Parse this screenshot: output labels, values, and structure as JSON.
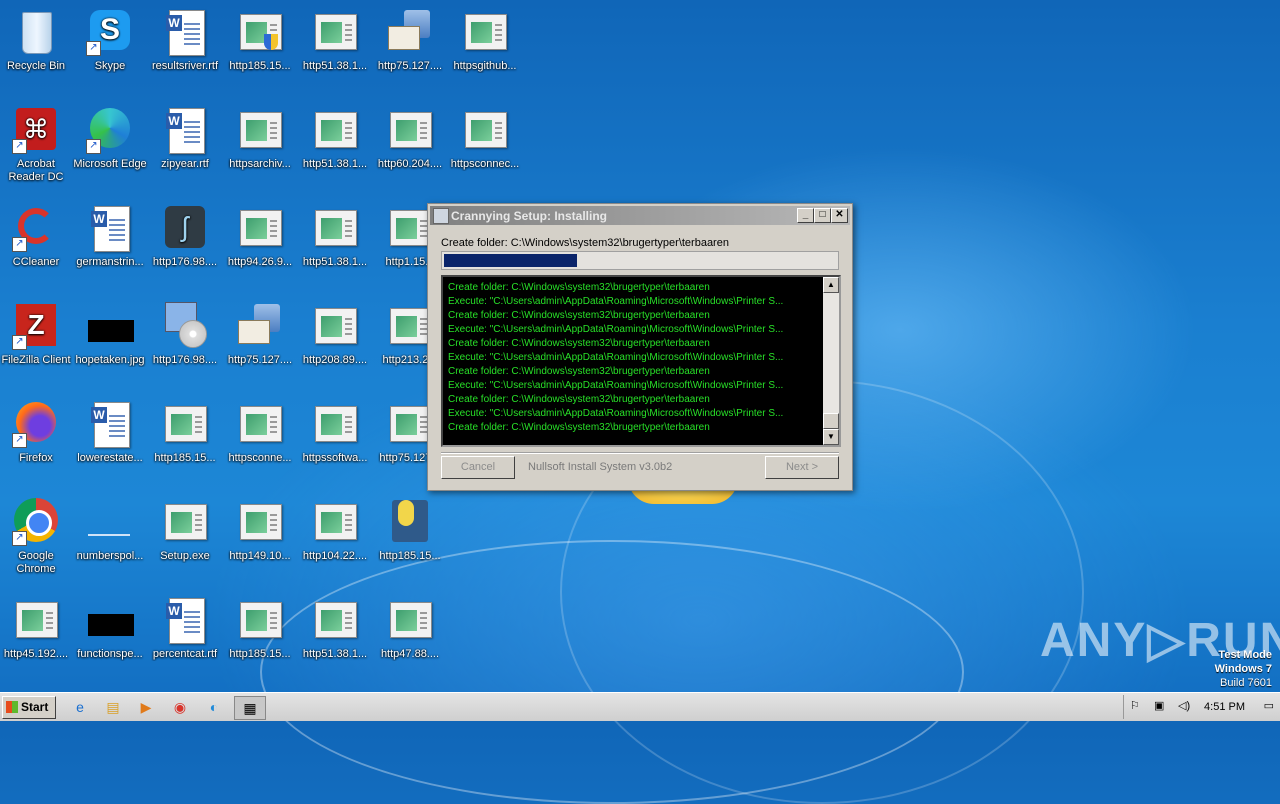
{
  "desktop": {
    "icons": [
      {
        "label": "Recycle Bin",
        "type": "recycle"
      },
      {
        "label": "Skype",
        "type": "skype"
      },
      {
        "label": "resultsriver.rtf",
        "type": "doc"
      },
      {
        "label": "http185.15...",
        "type": "web-shield"
      },
      {
        "label": "http51.38.1...",
        "type": "web"
      },
      {
        "label": "http75.127....",
        "type": "mail"
      },
      {
        "label": "httpsgithub...",
        "type": "web"
      },
      {
        "label": "Acrobat Reader DC",
        "type": "acrobat"
      },
      {
        "label": "Microsoft Edge",
        "type": "edge"
      },
      {
        "label": "zipyear.rtf",
        "type": "doc"
      },
      {
        "label": "httpsarchiv...",
        "type": "web"
      },
      {
        "label": "http51.38.1...",
        "type": "web"
      },
      {
        "label": "http60.204....",
        "type": "web"
      },
      {
        "label": "httpsconnec...",
        "type": "web"
      },
      {
        "label": "CCleaner",
        "type": "ccleaner"
      },
      {
        "label": "germanstrin...",
        "type": "doc"
      },
      {
        "label": "http176.98....",
        "type": "tool"
      },
      {
        "label": "http94.26.9...",
        "type": "web"
      },
      {
        "label": "http51.38.1...",
        "type": "web"
      },
      {
        "label": "http1.15...",
        "type": "web"
      },
      {
        "label": "FileZilla Client",
        "type": "filezilla"
      },
      {
        "label": "hopetaken.jpg",
        "type": "black"
      },
      {
        "label": "http176.98....",
        "type": "disc"
      },
      {
        "label": "http75.127....",
        "type": "mail"
      },
      {
        "label": "http208.89....",
        "type": "web"
      },
      {
        "label": "http213.2...",
        "type": "web"
      },
      {
        "label": "Firefox",
        "type": "firefox"
      },
      {
        "label": "lowerestate...",
        "type": "doc"
      },
      {
        "label": "http185.15...",
        "type": "web"
      },
      {
        "label": "httpsconne...",
        "type": "web"
      },
      {
        "label": "httpssoftwa...",
        "type": "web"
      },
      {
        "label": "http75.127...",
        "type": "web"
      },
      {
        "label": "Google Chrome",
        "type": "chrome"
      },
      {
        "label": "numberspol...",
        "type": "blank"
      },
      {
        "label": "Setup.exe",
        "type": "web"
      },
      {
        "label": "http149.10...",
        "type": "web"
      },
      {
        "label": "http104.22....",
        "type": "web"
      },
      {
        "label": "http185.15...",
        "type": "python"
      },
      {
        "label": "http45.192....",
        "type": "web"
      },
      {
        "label": "functionspe...",
        "type": "black"
      },
      {
        "label": "percentcat.rtf",
        "type": "doc"
      },
      {
        "label": "http185.15...",
        "type": "web"
      },
      {
        "label": "http51.38.1...",
        "type": "web"
      },
      {
        "label": "http47.88....",
        "type": "web"
      },
      {
        "label": "http185.15...",
        "type": "web"
      }
    ]
  },
  "dialog": {
    "title": "Crannying Setup: Installing",
    "status": "Create folder: C:\\Windows\\system32\\brugertyper\\terbaaren",
    "progress": 0.34,
    "log": [
      "Create folder: C:\\Windows\\system32\\brugertyper\\terbaaren",
      "Execute: \"C:\\Users\\admin\\AppData\\Roaming\\Microsoft\\Windows\\Printer S...",
      "Create folder: C:\\Windows\\system32\\brugertyper\\terbaaren",
      "Execute: \"C:\\Users\\admin\\AppData\\Roaming\\Microsoft\\Windows\\Printer S...",
      "Create folder: C:\\Windows\\system32\\brugertyper\\terbaaren",
      "Execute: \"C:\\Users\\admin\\AppData\\Roaming\\Microsoft\\Windows\\Printer S...",
      "Create folder: C:\\Windows\\system32\\brugertyper\\terbaaren",
      "Execute: \"C:\\Users\\admin\\AppData\\Roaming\\Microsoft\\Windows\\Printer S...",
      "Create folder: C:\\Windows\\system32\\brugertyper\\terbaaren",
      "Execute: \"C:\\Users\\admin\\AppData\\Roaming\\Microsoft\\Windows\\Printer S...",
      "Create folder: C:\\Windows\\system32\\brugertyper\\terbaaren"
    ],
    "cancel_label": "Cancel",
    "brand": "Nullsoft Install System v3.0b2",
    "next_label": "Next >"
  },
  "taskbar": {
    "start_label": "Start",
    "clock": "4:51 PM",
    "apps": [
      "ie-icon",
      "explorer-icon",
      "media-player-icon",
      "chrome-icon",
      "edge-icon",
      "installer-icon"
    ]
  },
  "watermark": {
    "line1": "Test Mode",
    "line2": "Windows 7",
    "line3": "Build 7601",
    "brand": "ANY▷RUN"
  },
  "colors": {
    "log_text": "#28e028",
    "progress_fill": "#0a246a"
  }
}
